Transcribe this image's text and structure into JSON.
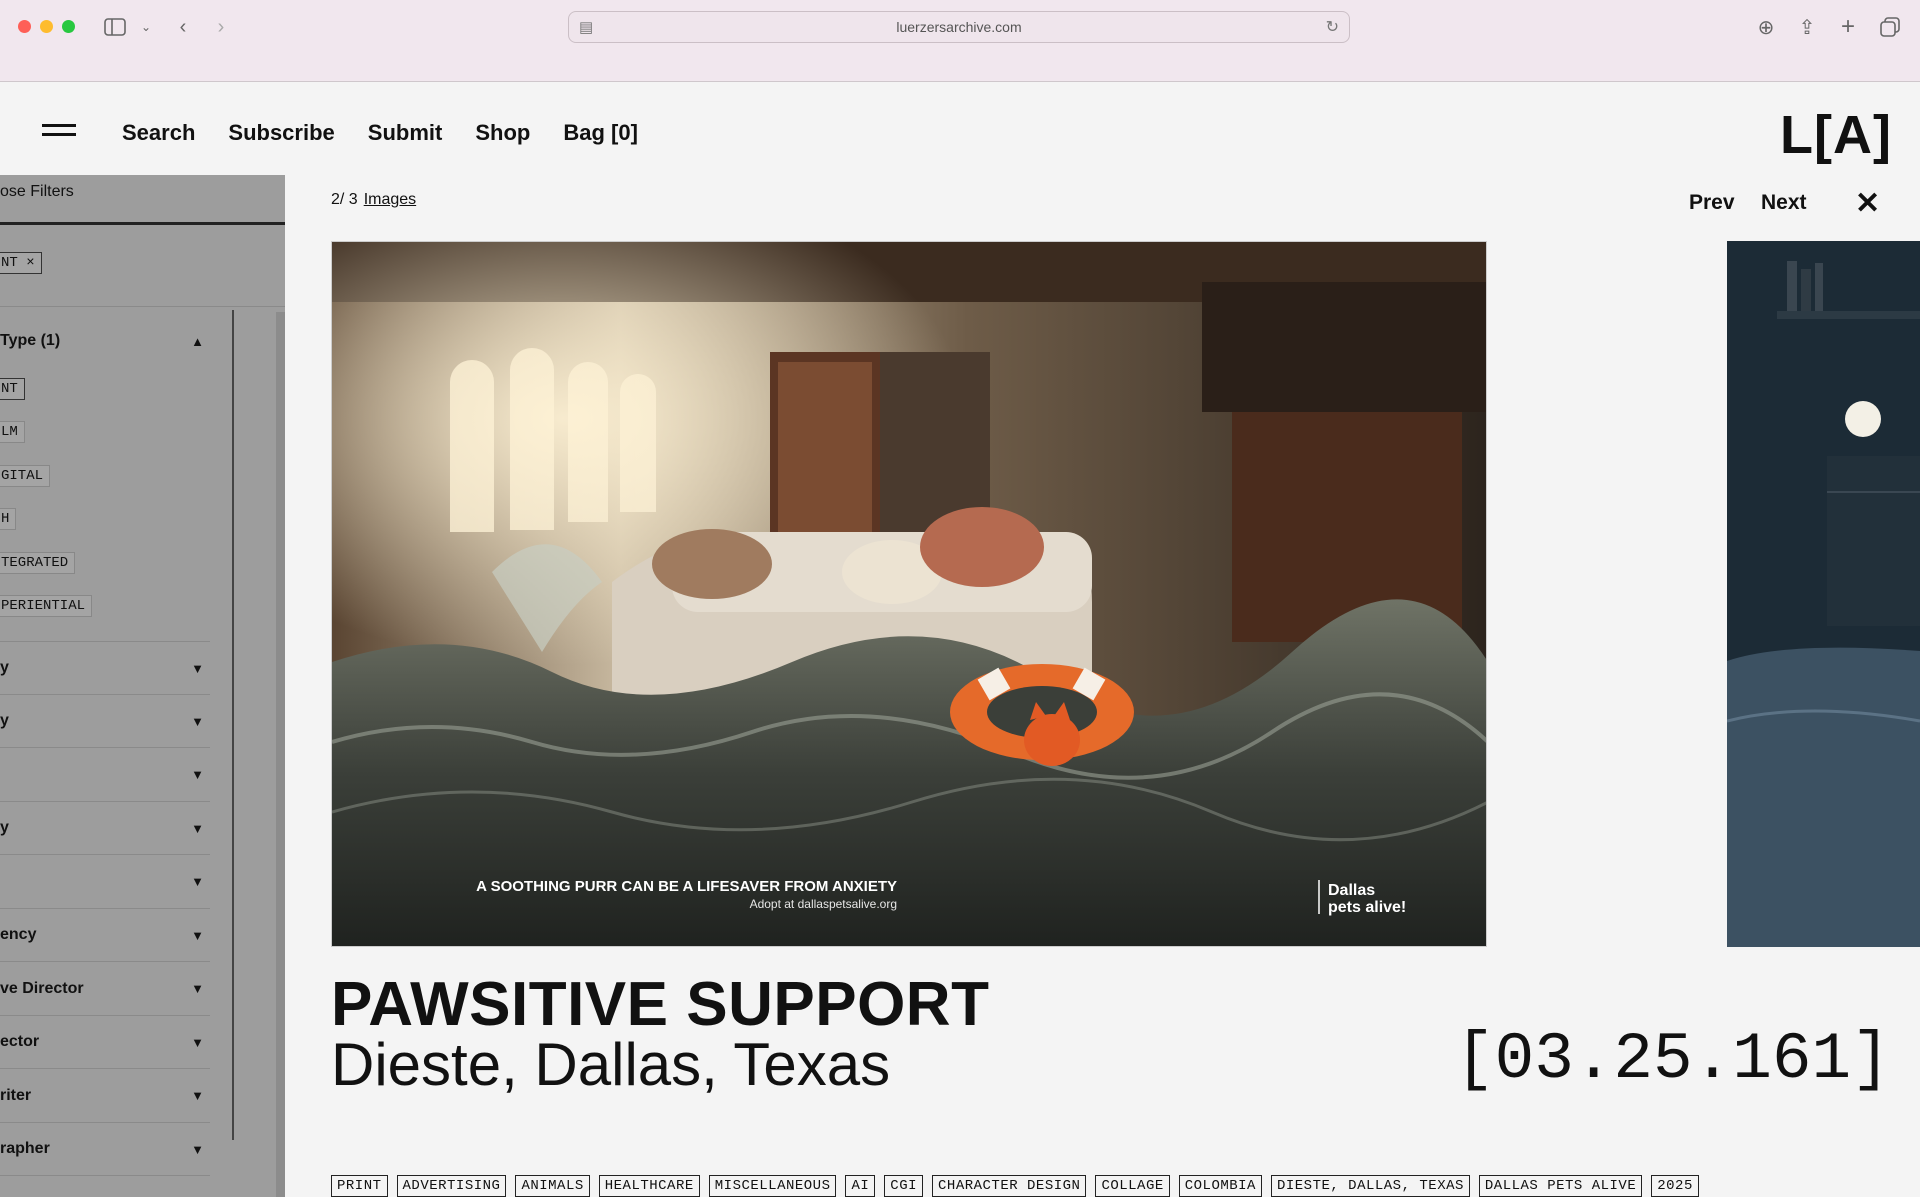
{
  "browser": {
    "url": "luerzersarchive.com",
    "traffic_colors": [
      "#fe5f57",
      "#febc2e",
      "#28c840"
    ]
  },
  "nav": {
    "links": [
      "Search",
      "Subscribe",
      "Submit",
      "Shop",
      "Bag [0]"
    ],
    "logo": "L[A]"
  },
  "filters": {
    "close_label": "ose Filters",
    "active_chip": "NT ×",
    "section_title": "Type (1)",
    "type_options": [
      "NT",
      "LM",
      "GITAL",
      "H",
      "TEGRATED",
      "PERIENTIAL"
    ],
    "collapsed_sections": [
      "y",
      "y",
      "",
      "y",
      "",
      "ency",
      "ve Director",
      "ector",
      "riter",
      "rapher"
    ]
  },
  "viewer": {
    "counter": "2/ 3",
    "images_link": "Images",
    "prev": "Prev",
    "next": "Next",
    "close": "✕",
    "ad_headline": "A SOOTHING PURR CAN BE A LIFESAVER FROM ANXIETY",
    "ad_sub": "Adopt at dallaspetsalive.org",
    "ad_brand_line1": "Dallas",
    "ad_brand_line2": "pets alive!",
    "title": "PAWSITIVE SUPPORT",
    "subtitle": "Dieste, Dallas, Texas",
    "code": "[03.25.161]",
    "tags": [
      "PRINT",
      "ADVERTISING",
      "ANIMALS",
      "HEALTHCARE",
      "MISCELLANEOUS",
      "AI",
      "CGI",
      "CHARACTER DESIGN",
      "COLLAGE",
      "COLOMBIA",
      "DIESTE, DALLAS, TEXAS",
      "DALLAS PETS ALIVE",
      "2025"
    ]
  }
}
